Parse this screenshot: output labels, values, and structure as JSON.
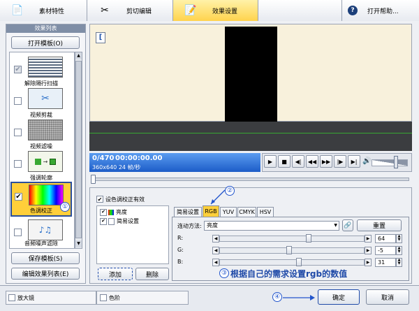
{
  "tabs": [
    {
      "label": "素材特性",
      "icon": "document-icon"
    },
    {
      "label": "剪切编辑",
      "icon": "scissors-icon"
    },
    {
      "label": "效果设置",
      "icon": "edit-icon"
    },
    {
      "label": "打开帮助...",
      "icon": "help-icon"
    }
  ],
  "sidebar": {
    "title": "效果列表",
    "open_template": "打开模板(O)",
    "save_template": "保存模板(S)",
    "edit_list": "编辑效果列表(E)",
    "items": [
      {
        "label": "解除隔行扫描",
        "checked": true
      },
      {
        "label": "视频剪裁",
        "checked": false
      },
      {
        "label": "视频滤噪",
        "checked": false
      },
      {
        "label": "强调轮廓",
        "checked": false
      },
      {
        "label": "色调校正",
        "checked": true
      },
      {
        "label": "音频噪声滤除",
        "checked": false
      }
    ]
  },
  "preview": {
    "corner_glyph": "[",
    "frame": "0/470",
    "timecode": "00:00:00.00",
    "info": "360x640 24 帧/秒"
  },
  "color": {
    "enable_label": "设色调校正有效",
    "tree": [
      "亮度",
      "简易设置"
    ],
    "add": "添加",
    "delete": "删除",
    "tabs": [
      "简易设置",
      "RGB",
      "YUV",
      "CMYK",
      "HSV"
    ],
    "link_label": "连动方法:",
    "link_value": "亮度",
    "reset": "重置",
    "channels": [
      {
        "name": "R:",
        "value": "64",
        "level": 0.62
      },
      {
        "name": "G:",
        "value": "-5",
        "level": 0.48
      },
      {
        "name": "B:",
        "value": "31",
        "level": 0.55
      }
    ]
  },
  "markers": {
    "m1": "①",
    "m2": "②",
    "m3": "③",
    "m4": "④"
  },
  "annotation": "根据自己的需求设置rgb的数值",
  "bottom": {
    "magnifier": "放大镜",
    "levels": "色阶",
    "ok": "确定",
    "cancel": "取消"
  }
}
